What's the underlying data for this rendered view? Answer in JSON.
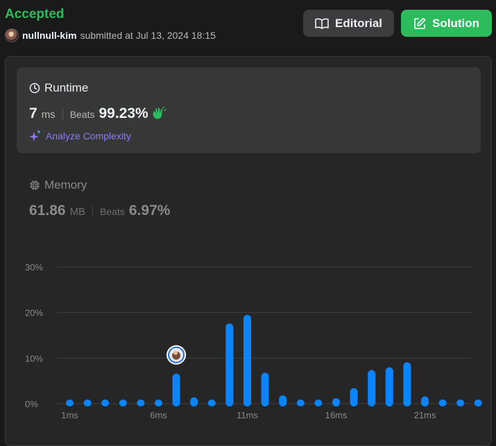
{
  "header": {
    "status": "Accepted",
    "username": "nullnull-kim",
    "submitted_text": "submitted at Jul 13, 2024 18:15",
    "editorial_label": "Editorial",
    "solution_label": "Solution"
  },
  "runtime": {
    "title": "Runtime",
    "value": "7",
    "unit": "ms",
    "beats_label": "Beats",
    "beats_value": "99.23%",
    "analyze_label": "Analyze Complexity"
  },
  "memory": {
    "title": "Memory",
    "value": "61.86",
    "unit": "MB",
    "beats_label": "Beats",
    "beats_value": "6.97%"
  },
  "colors": {
    "accepted": "#2cbb5d",
    "bar": "#0a84ff",
    "analyze": "#8b7cf6"
  },
  "chart_data": {
    "type": "bar",
    "ylim": [
      0,
      30
    ],
    "y_ticks": [
      "0%",
      "10%",
      "20%",
      "30%"
    ],
    "x_tick_labels": [
      "1ms",
      "6ms",
      "11ms",
      "16ms",
      "21ms"
    ],
    "x": [
      1,
      2,
      3,
      4,
      5,
      6,
      7,
      8,
      9,
      10,
      11,
      12,
      13,
      14,
      15,
      16,
      17,
      18,
      19,
      20,
      21,
      22,
      23,
      24
    ],
    "values": [
      0.6,
      0.6,
      0.6,
      0.6,
      0.6,
      0.6,
      6.6,
      1.4,
      0.6,
      17.6,
      19.5,
      6.8,
      1.8,
      0.6,
      0.6,
      1.2,
      3.4,
      7.4,
      8.0,
      9.1,
      1.6,
      0.6,
      0.6,
      0.6
    ],
    "highlight_x": 7
  }
}
